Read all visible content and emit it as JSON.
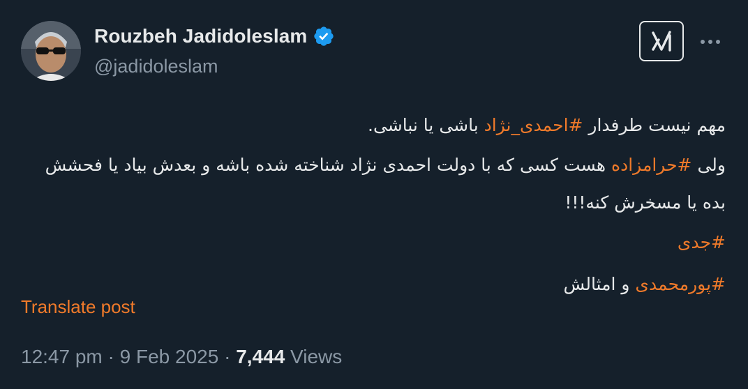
{
  "author": {
    "display_name": "Rouzbeh Jadidoleslam",
    "handle": "@jadidoleslam",
    "verified": true,
    "avatar_icon": "avatar-photo"
  },
  "icons": {
    "grok": "grok-icon",
    "more": "more-dots-icon",
    "verified": "verified-badge-icon"
  },
  "body": {
    "line1_pre": "مهم نیست طرفدار ",
    "line1_tag": "#احمدی_نژاد",
    "line1_post": " باشی یا نباشی.",
    "line2_pre": "ولی ",
    "line2_tag": "#حرامزاده",
    "line2_post": " هست کسی که با دولت احمدی نژاد شناخته شده باشه و بعدش بیاد یا فحشش بده یا مسخرش کنه!!!",
    "line3_tag": "#جدی",
    "line4_tag": "#پورمحمدی",
    "line4_post": " و امثالش"
  },
  "translate_label": "Translate post",
  "meta": {
    "time": "12:47 pm",
    "sep1": " · ",
    "date": "9 Feb 2025",
    "sep2": " · ",
    "views_count": "7,444",
    "views_label": " Views"
  },
  "colors": {
    "background": "#15202b",
    "text": "#e7e9ea",
    "muted": "#8b98a5",
    "hashtag": "#f07a2a",
    "verified": "#1d9bf0"
  }
}
